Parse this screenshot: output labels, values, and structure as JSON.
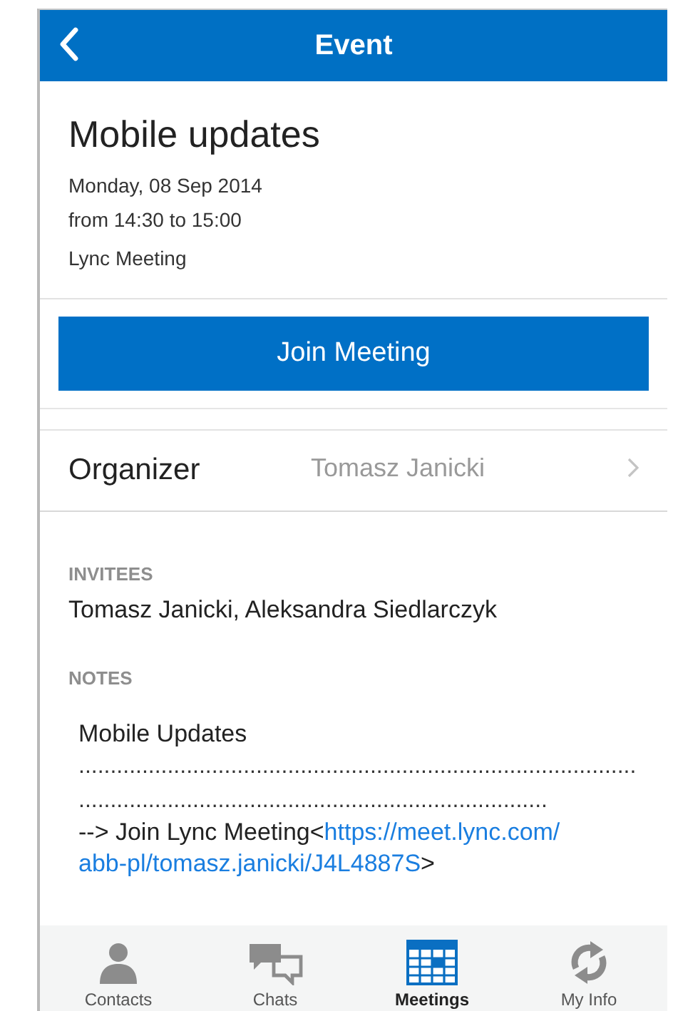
{
  "nav": {
    "title": "Event"
  },
  "event": {
    "title": "Mobile updates",
    "date": "Monday, 08 Sep 2014",
    "time": "from 14:30 to 15:00",
    "type": "Lync Meeting"
  },
  "join_button": "Join Meeting",
  "organizer": {
    "label": "Organizer",
    "value": "Tomasz Janicki"
  },
  "invitees": {
    "heading": "INVITEES",
    "text": "Tomasz Janicki, Aleksandra Siedlarczyk"
  },
  "notes": {
    "heading": "NOTES",
    "title": "Mobile Updates",
    "separators": [
      "........................................................................................",
      ".........................................................................."
    ],
    "join_line": {
      "prefix": "--> Join Lync Meeting<",
      "link": "https://meet.lync.com/abb-pl/tomasz.janicki/J4L4887S",
      "suffix": ">"
    }
  },
  "tabs": [
    {
      "label": "Contacts",
      "selected": false
    },
    {
      "label": "Chats",
      "selected": false
    },
    {
      "label": "Meetings",
      "selected": true
    },
    {
      "label": "My Info",
      "selected": false
    }
  ]
}
